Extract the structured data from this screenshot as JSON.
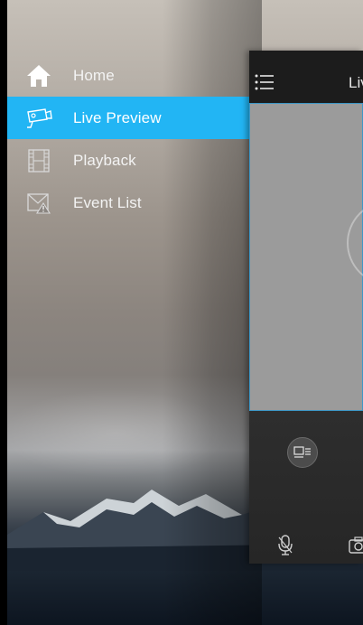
{
  "menu": {
    "items": [
      {
        "label": "Home",
        "icon": "home-icon",
        "active": false
      },
      {
        "label": "Live Preview",
        "icon": "camera-icon",
        "active": true
      },
      {
        "label": "Playback",
        "icon": "film-icon",
        "active": false
      },
      {
        "label": "Event List",
        "icon": "alert-mail-icon",
        "active": false
      }
    ]
  },
  "panel": {
    "title": "Liv"
  },
  "colors": {
    "active": "#22b5f4",
    "panel": "#282828",
    "video": "#9b9b9b"
  }
}
